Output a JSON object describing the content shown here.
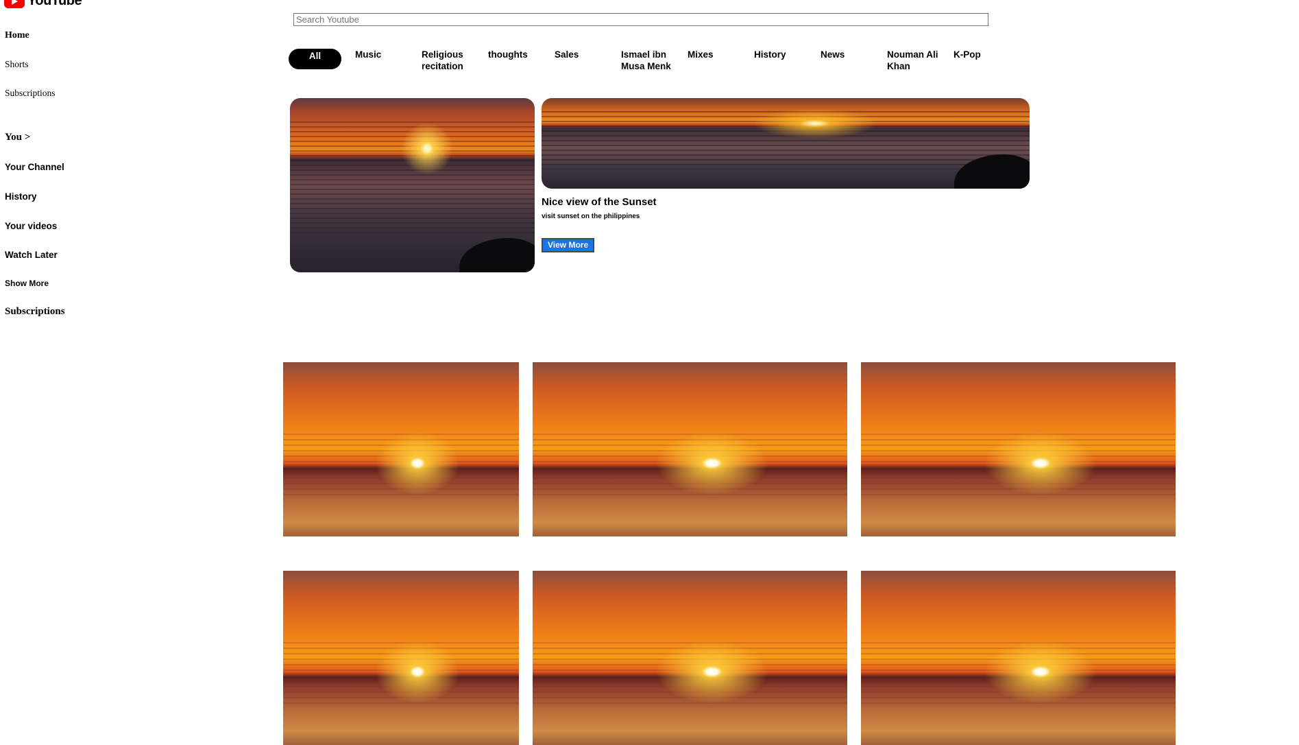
{
  "app": {
    "logo_text": "YouTube"
  },
  "sidebar": {
    "home": "Home",
    "shorts": "Shorts",
    "subscriptions": "Subscriptions",
    "you": "You >",
    "your_channel": "Your Channel",
    "history": "History",
    "your_videos": "Your videos",
    "watch_later": "Watch Later",
    "show_more": "Show More",
    "subscriptions_heading": "Subscriptions"
  },
  "search": {
    "placeholder": "Search Youtube",
    "value": ""
  },
  "chips": [
    "All",
    "Music",
    "Religious recitation",
    "thoughts",
    "Sales",
    "Ismael ibn Musa Menk",
    "Mixes",
    "History",
    "News",
    "Nouman Ali Khan",
    "K-Pop"
  ],
  "featured": {
    "title": "Nice view of the Sunset",
    "description": "visit sunset on the philippines",
    "button_label": "View More"
  },
  "colors": {
    "brand": "#ff0000",
    "button": "#1a73e8",
    "chip_active": "#000000"
  }
}
